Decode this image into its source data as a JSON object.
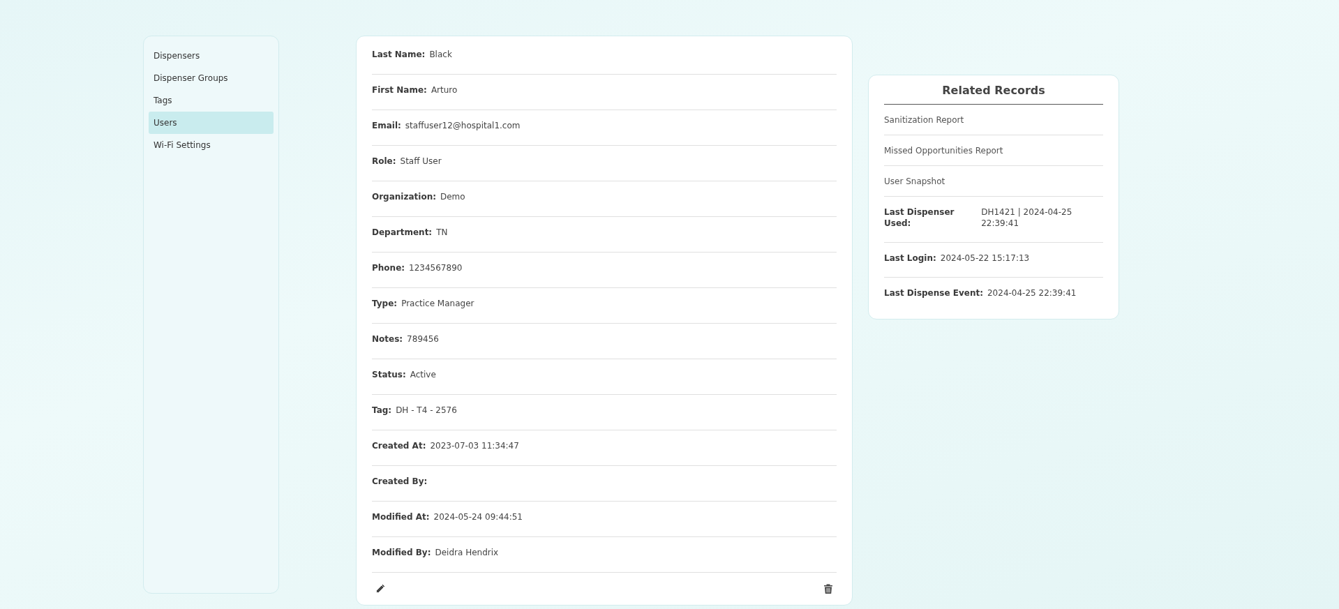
{
  "sidebar": {
    "items": [
      {
        "label": "Dispensers",
        "selected": false
      },
      {
        "label": "Dispenser Groups",
        "selected": false
      },
      {
        "label": "Tags",
        "selected": false
      },
      {
        "label": "Users",
        "selected": true
      },
      {
        "label": "Wi-Fi Settings",
        "selected": false
      }
    ]
  },
  "details": {
    "fields": [
      {
        "label": "Last Name:",
        "value": "Black"
      },
      {
        "label": "First Name:",
        "value": "Arturo"
      },
      {
        "label": "Email:",
        "value": "staffuser12@hospital1.com"
      },
      {
        "label": "Role:",
        "value": "Staff User"
      },
      {
        "label": "Organization:",
        "value": "Demo"
      },
      {
        "label": "Department:",
        "value": "TN"
      },
      {
        "label": "Phone:",
        "value": "1234567890"
      },
      {
        "label": "Type:",
        "value": "Practice Manager"
      },
      {
        "label": "Notes:",
        "value": "789456"
      },
      {
        "label": "Status:",
        "value": "Active"
      },
      {
        "label": "Tag:",
        "value": "DH - T4 - 2576"
      },
      {
        "label": "Created At:",
        "value": "2023-07-03 11:34:47"
      },
      {
        "label": "Created By:"
      },
      {
        "label": "Modified At:",
        "value": "2024-05-24 09:44:51"
      },
      {
        "label": "Modified By:",
        "value": "Deidra Hendrix"
      }
    ]
  },
  "related_records": {
    "title": "Related Records",
    "links": [
      "Sanitization Report",
      "Missed Opportunities Report",
      "User Snapshot"
    ],
    "fields": [
      {
        "label": "Last Dispenser Used:",
        "value": "DH1421 | 2024-04-25 22:39:41"
      },
      {
        "label": "Last Login:",
        "value": "2024-05-22 15:17:13"
      },
      {
        "label": "Last Dispense Event:",
        "value": "2024-04-25 22:39:41"
      }
    ]
  }
}
